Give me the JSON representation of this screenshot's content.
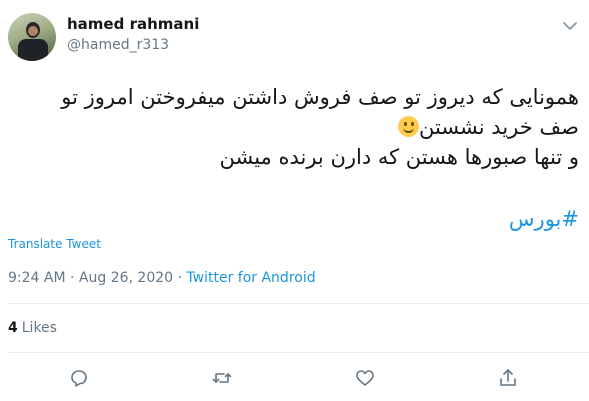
{
  "tweet": {
    "author_name": "hamed rahmani",
    "author_handle": "@hamed_r313",
    "text_lines": [
      "همونایی که دیروز تو صف فروش داشتن میفروختن امروز تو",
      "صف خرید نشستن",
      "و تنها صبورها هستن که دارن برنده میشن"
    ],
    "hashtag": "#بورس",
    "translate_label": "Translate Tweet",
    "time": "9:24 AM",
    "date": "Aug 26, 2020",
    "separator": "·",
    "source": "Twitter for Android",
    "likes_count": "4",
    "likes_label": "Likes"
  },
  "colors": {
    "link": "#1b95e0",
    "secondary_text": "#657786",
    "divider": "#e6ecf0"
  },
  "icons": [
    "chevron-down-icon",
    "reply-icon",
    "retweet-icon",
    "like-icon",
    "share-icon",
    "smiling-face-emoji"
  ]
}
